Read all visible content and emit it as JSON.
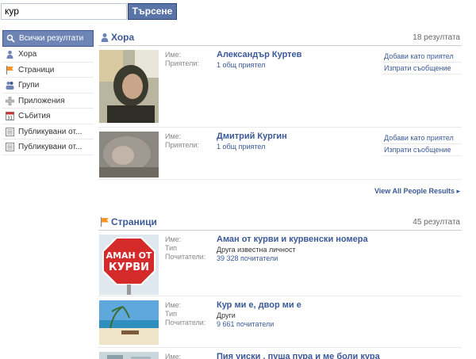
{
  "search": {
    "value": "кур",
    "button_label": "Търсене"
  },
  "sidebar": {
    "items": [
      {
        "label": "Всички резултати",
        "icon": "search-icon",
        "active": true
      },
      {
        "label": "Хора",
        "icon": "person-icon"
      },
      {
        "label": "Страници",
        "icon": "flag-icon"
      },
      {
        "label": "Групи",
        "icon": "group-icon"
      },
      {
        "label": "Приложения",
        "icon": "puzzle-icon"
      },
      {
        "label": "Събития",
        "icon": "calendar-icon"
      },
      {
        "label": "Публикувани от...",
        "icon": "feed-icon"
      },
      {
        "label": "Публикувани от...",
        "icon": "feed-icon"
      }
    ]
  },
  "people": {
    "title": "Хора",
    "count": "18 резултата",
    "results": [
      {
        "name_label": "Име:",
        "friends_label": "Приятели:",
        "name": "Александър Куртев",
        "mutual": "1 общ приятел",
        "add_friend": "Добави като приятел",
        "send_message": "Изпрати съобщение"
      },
      {
        "name_label": "Име:",
        "friends_label": "Приятели:",
        "name": "Дмитрий Кургин",
        "mutual": "1 общ приятел",
        "add_friend": "Добави като приятел",
        "send_message": "Изпрати съобщение"
      }
    ],
    "view_all": "View All People Results ▸"
  },
  "pages": {
    "title": "Страници",
    "count": "45 резултата",
    "results": [
      {
        "name_label": "Име:",
        "type_label": "Тип",
        "fans_label": "Почитатели:",
        "name": "Аман от курви и курвенски номера",
        "type": "Друга известна личност",
        "fans": "39 328 почитатели",
        "sign_line1": "АМАН ОТ",
        "sign_line2": "КУРВИ"
      },
      {
        "name_label": "Име:",
        "type_label": "Тип",
        "fans_label": "Почитатели:",
        "name": "Кур ми е, двор ми е",
        "type": "Други",
        "fans": "9 661 почитатели"
      },
      {
        "name_label": "Име:",
        "name": "Пия уиски , пуша пура и ме боли кура"
      }
    ]
  }
}
